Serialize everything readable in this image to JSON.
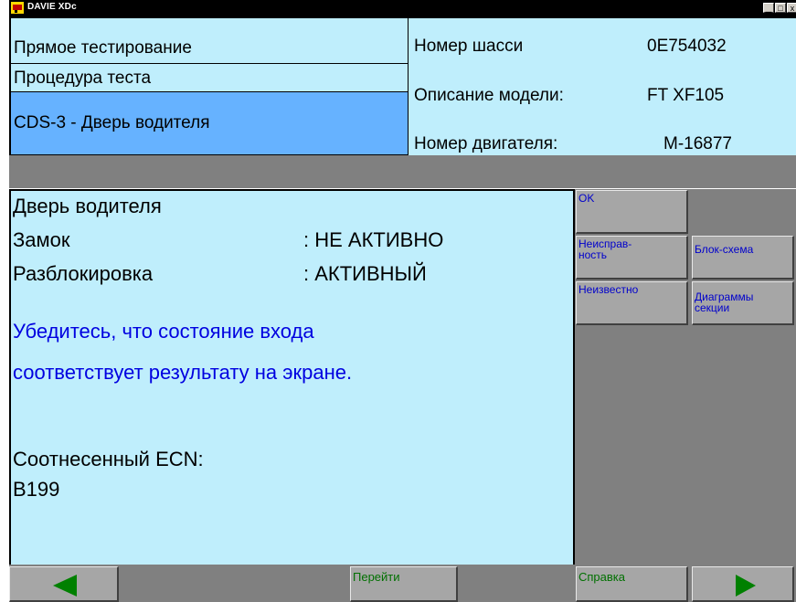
{
  "window": {
    "title": "DAVIE XDc",
    "minimize": "▁",
    "maximize": "□",
    "close": "x"
  },
  "header": {
    "left": {
      "mode": "Прямое тестирование",
      "procedure": "Процедура теста",
      "test_name": "CDS-3 - Дверь водителя"
    },
    "right": {
      "chassis_label": "Номер шасси",
      "chassis_value": "0E754032",
      "model_label": "Описание модели:",
      "model_value": "FT XF105",
      "engine_label": "Номер двигателя:",
      "engine_value": "M-16877"
    }
  },
  "main": {
    "heading": "Дверь водителя",
    "rows": [
      {
        "label": "Замок",
        "value": ": НЕ АКТИВНО"
      },
      {
        "label": "Разблокировка",
        "value": ": АКТИВНЫЙ"
      }
    ],
    "instruction_line1": "Убедитесь, что состояние входа",
    "instruction_line2": "соответствует результату на экране.",
    "ecn_label": "Соотнесенный ECN:",
    "ecn_value": "B199"
  },
  "side_buttons": {
    "ok": "OK",
    "fault_line1": "Неисправ-",
    "fault_line2": "ность",
    "block_diagram": "Блок-схема",
    "unknown": "Неизвестно",
    "section_line1": "Диаграммы",
    "section_line2": "секции"
  },
  "bottom_bar": {
    "goto": "Перейти",
    "help": "Справка"
  },
  "colors": {
    "panel": "#bfeefc",
    "selected": "#66b2ff",
    "button": "#a6a6a6",
    "instruction": "#0000e0",
    "arrow": "#008000"
  }
}
